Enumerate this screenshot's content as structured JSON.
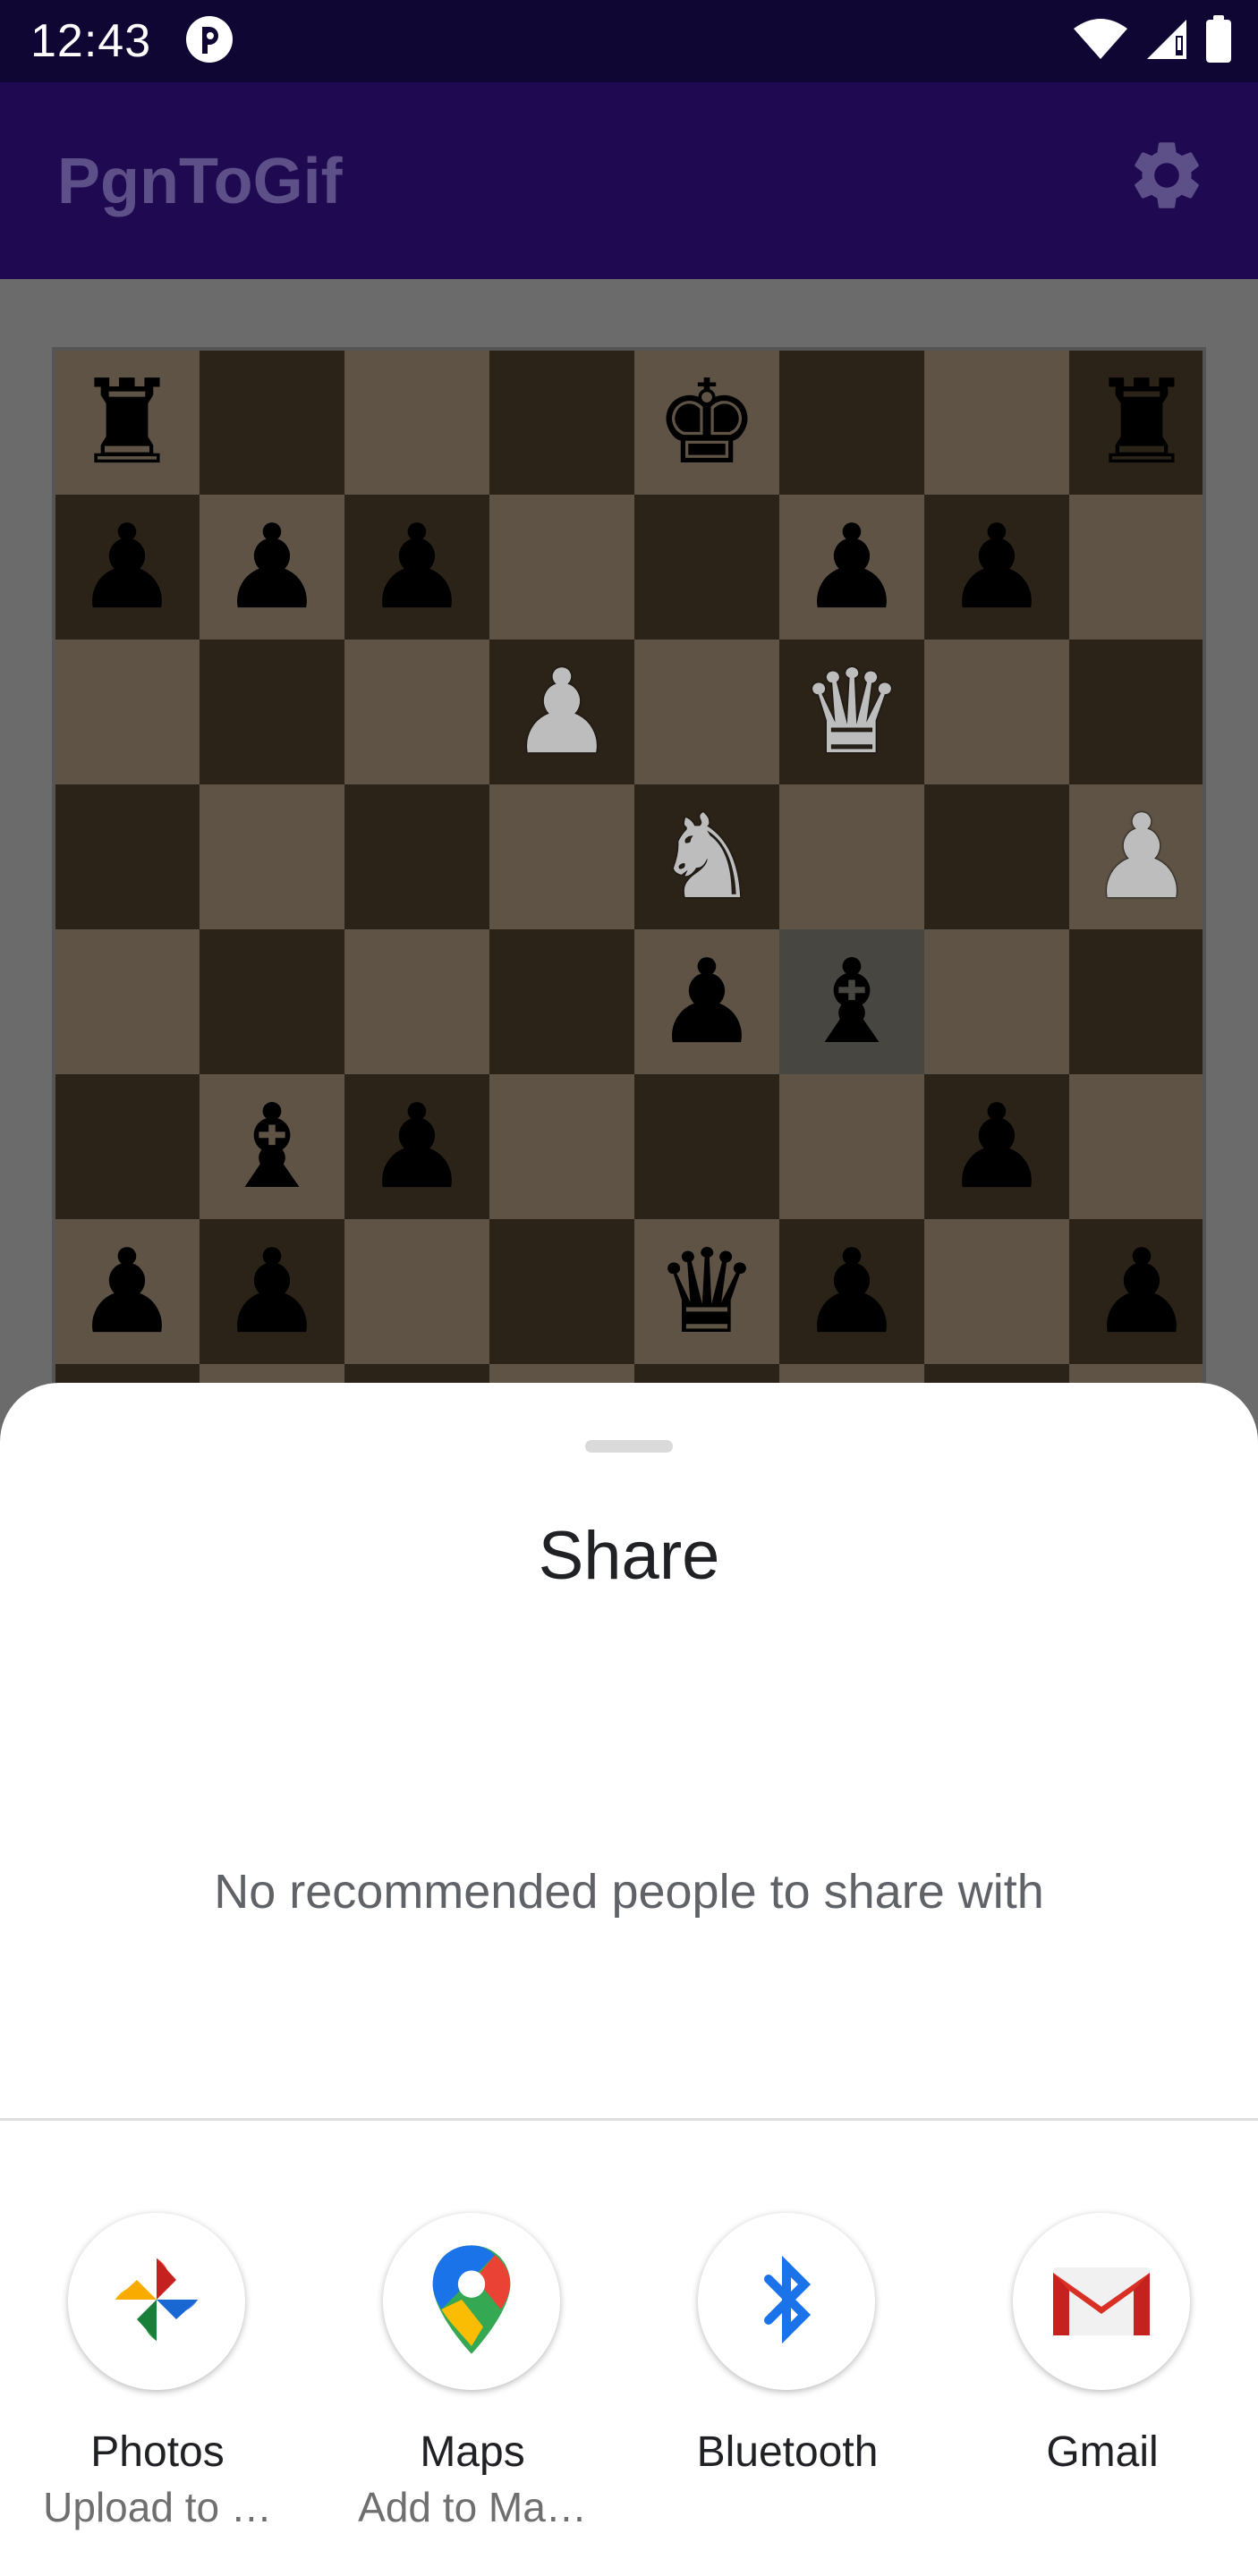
{
  "status_bar": {
    "time": "12:43",
    "icons": [
      "app-notification-icon",
      "wifi-icon",
      "signal-icon",
      "battery-icon"
    ]
  },
  "app_bar": {
    "title": "PgnToGif",
    "actions": [
      "settings-gear-icon"
    ]
  },
  "board": {
    "position_fen": "r3k2r/ppp2pp1/3P1Q2/4N2P/4pb2/1bp3p1/pp2qp1p/8",
    "highlighted_squares": [
      "f4"
    ],
    "colors": {
      "light": "#5e5345",
      "dark": "#2c2318",
      "highlight": "#474640"
    }
  },
  "share_sheet": {
    "title": "Share",
    "empty_message": "No recommended people to share with",
    "targets": [
      {
        "label": "Photos",
        "sublabel": "Upload to …",
        "icon": "google-photos-icon"
      },
      {
        "label": "Maps",
        "sublabel": "Add to Ma…",
        "icon": "google-maps-icon"
      },
      {
        "label": "Bluetooth",
        "sublabel": "",
        "icon": "bluetooth-icon"
      },
      {
        "label": "Gmail",
        "sublabel": "",
        "icon": "gmail-icon"
      }
    ]
  }
}
